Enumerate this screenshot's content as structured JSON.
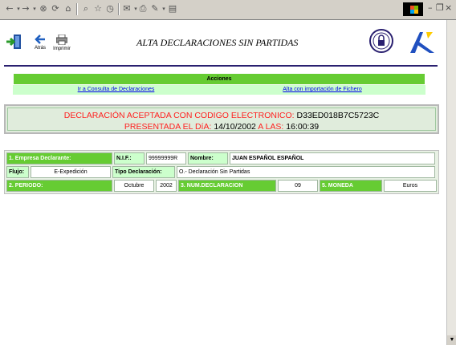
{
  "header": {
    "exit_label": "",
    "back_label": "Atrás",
    "print_label": "Imprimir",
    "title": "ALTA DECLARACIONES SIN PARTIDAS",
    "seal_text": "AREA SEGURA"
  },
  "acciones": {
    "title": "Acciones",
    "link_consulta": "Ir a Consulta de Declaraciones",
    "link_alta": "Alta con importación de Fichero"
  },
  "status": {
    "line1_prefix": "DECLARACIÓN ACEPTADA CON CODIGO ELECTRONICO:",
    "code": "D33ED018B7C5723C",
    "line2_prefix": "PRESENTADA EL DíA:",
    "date": "14/10/2002",
    "at_label": "A LAS:",
    "time": "16:00:39"
  },
  "table": {
    "empresa_label": "1. Empresa Declarante:",
    "nif_label": "N.I.F.:",
    "nif_value": "99999999R",
    "nombre_label": "Nombre:",
    "nombre_value": "JUAN ESPAÑOL ESPAÑOL",
    "flujo_label": "Flujo:",
    "flujo_value": "E-Expedición",
    "tipo_label": "Tipo Declaración:",
    "tipo_value": "O.- Declaración Sin Partidas",
    "periodo_label": "2. PERIODO:",
    "periodo_mes": "Octubre",
    "periodo_anio": "2002",
    "numdecl_label": "3. NUM.DECLARACION",
    "numdecl_value": "09",
    "moneda_label": "5. MONEDA",
    "moneda_value": "Euros"
  },
  "colors": {
    "accent_green": "#66cc33",
    "light_green": "#ccffcc",
    "status_red": "#ff2020",
    "title_blue": "#2a2070"
  }
}
